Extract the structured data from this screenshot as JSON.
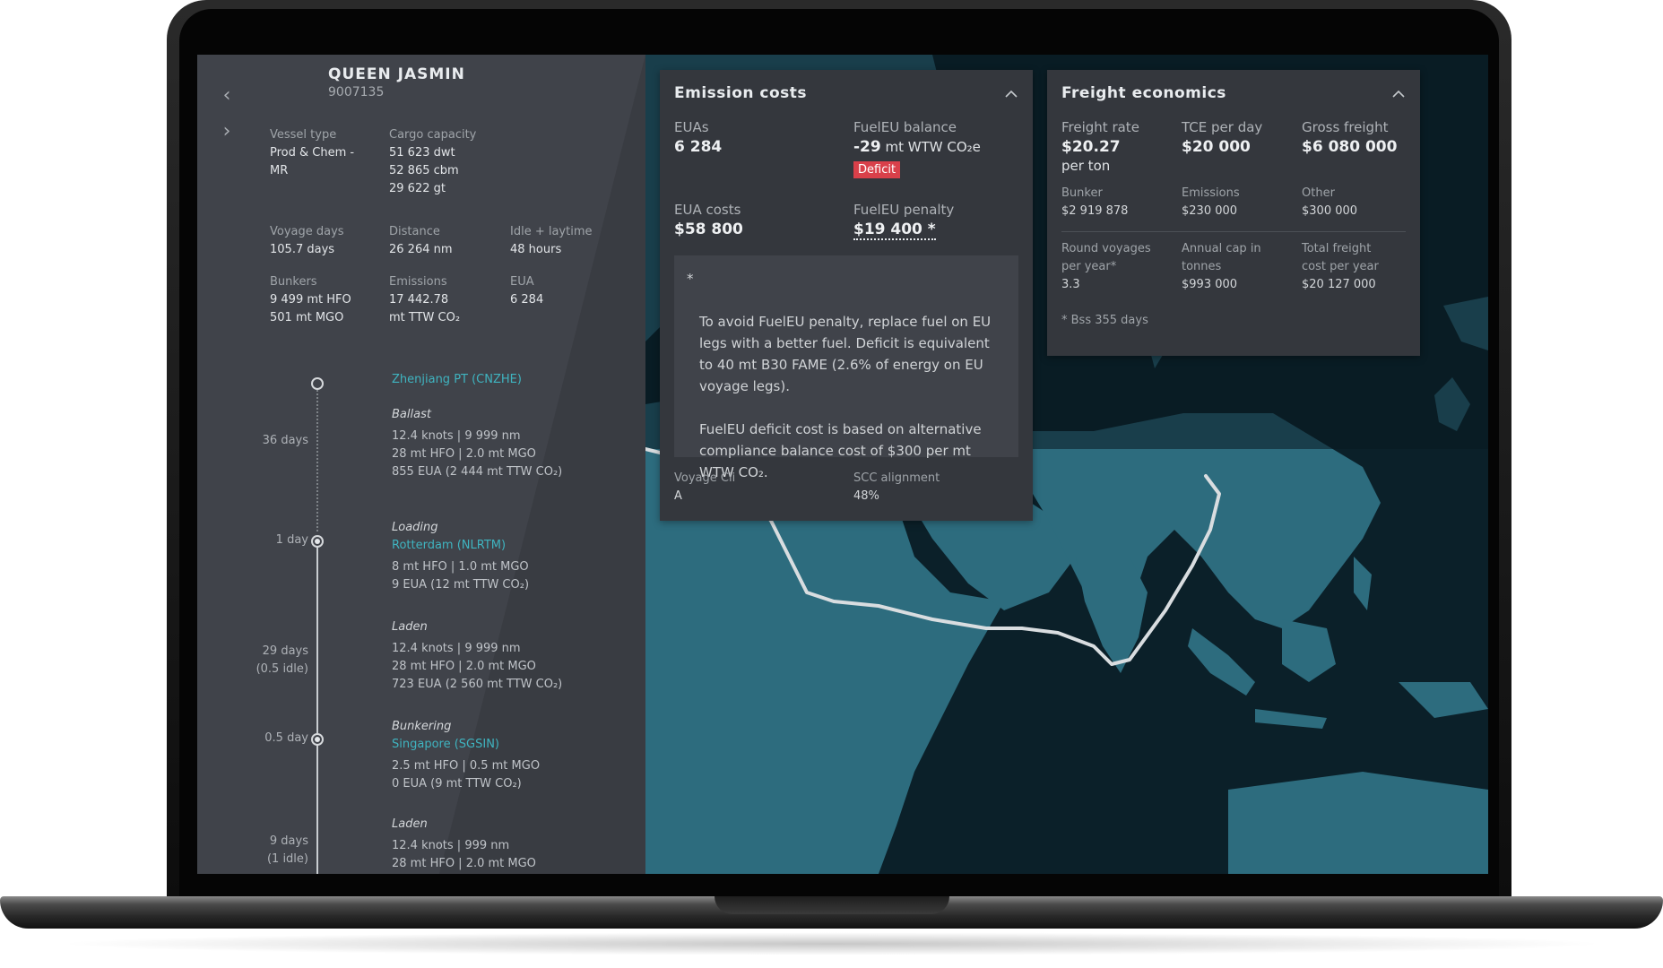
{
  "vessel": {
    "name": "QUEEN JASMIN",
    "imo": "9007135",
    "specs": {
      "vessel_type": {
        "label": "Vessel type",
        "value": "Prod & Chem -\nMR"
      },
      "cargo_capacity": {
        "label": "Cargo capacity",
        "value": "51 623 dwt\n52 865 cbm\n29 622 gt"
      },
      "voyage_days": {
        "label": "Voyage days",
        "value": "105.7 days"
      },
      "distance": {
        "label": "Distance",
        "value": "26 264 nm"
      },
      "idle_laytime": {
        "label": "Idle + laytime",
        "value": "48 hours"
      },
      "bunkers": {
        "label": "Bunkers",
        "value": "9 499 mt HFO\n501 mt MGO"
      },
      "emissions": {
        "label": "Emissions",
        "value": "17 442.78\nmt TTW CO₂"
      },
      "eua": {
        "label": "EUA",
        "value": "6 284"
      }
    }
  },
  "nav": {
    "prev": "‹",
    "next": "›"
  },
  "timeline": {
    "start_port": "Zhenjiang PT (CNZHE)",
    "legs": [
      {
        "days": "36 days",
        "type": "Ballast",
        "port": "",
        "detail": "12.4 knots | 9 999 nm\n28 mt HFO | 2.0 mt MGO\n855 EUA (2 444 mt TTW CO₂)"
      },
      {
        "days": "1 day",
        "type": "Loading",
        "port": "Rotterdam (NLRTM)",
        "detail": "8 mt HFO | 1.0 mt MGO\n9 EUA (12 mt TTW CO₂)"
      },
      {
        "days": "29 days\n(0.5 idle)",
        "type": "Laden",
        "port": "",
        "detail": "12.4 knots | 9 999 nm\n28 mt HFO | 2.0 mt MGO\n723 EUA (2 560 mt TTW CO₂)"
      },
      {
        "days": "0.5 day",
        "type": "Bunkering",
        "port": "Singapore (SGSIN)",
        "detail": "2.5 mt HFO | 0.5 mt MGO\n0 EUA (9 mt TTW CO₂)"
      },
      {
        "days": "9 days\n(1 idle)",
        "type": "Laden",
        "port": "",
        "detail": "12.4 knots | 999 nm\n28 mt HFO | 2.0 mt MGO"
      }
    ]
  },
  "emission_costs": {
    "title": "Emission costs",
    "euas": {
      "label": "EUAs",
      "value": "6 284"
    },
    "fueleu_balance": {
      "label": "FuelEU balance",
      "value": "-29",
      "unit": " mt WTW CO₂e",
      "badge": "Deficit"
    },
    "eua_costs": {
      "label": "EUA costs",
      "value": "$58 800"
    },
    "fueleu_penalty": {
      "label": "FuelEU penalty",
      "value": "$19 400 *"
    },
    "note_bullet": "*",
    "note": "To avoid FuelEU penalty, replace fuel on EU\nlegs with a better fuel. Deficit is equivalent\nto 40 mt B30 FAME (2.6% of energy on EU\nvoyage legs).\n\nFuelEU deficit cost is based on alternative\ncompliance balance cost of $300 per mt\nWTW CO₂.",
    "voyage_cii": {
      "label": "Voyage Cii",
      "value": "A"
    },
    "scc_alignment": {
      "label": "SCC alignment",
      "value": "48%"
    }
  },
  "freight_economics": {
    "title": "Freight economics",
    "freight_rate": {
      "label": "Freight rate",
      "value": "$20.27",
      "sub": "per ton"
    },
    "tce_per_day": {
      "label": "TCE per day",
      "value": "$20 000"
    },
    "gross_freight": {
      "label": "Gross freight",
      "value": "$6 080 000"
    },
    "bunker": {
      "label": "Bunker",
      "value": "$2 919 878"
    },
    "emissions": {
      "label": "Emissions",
      "value": "$230 000"
    },
    "other": {
      "label": "Other",
      "value": "$300 000"
    },
    "round_voyages": {
      "label": "Round voyages\nper year*",
      "value": "3.3"
    },
    "annual_cap": {
      "label": "Annual cap in\ntonnes",
      "value": "$993 000"
    },
    "total_freight_cost": {
      "label": "Total freight\ncost per year",
      "value": "$20 127 000"
    },
    "footnote": "* Bss 355 days"
  },
  "icons": {
    "collapse": "chevron-up-icon"
  },
  "colors": {
    "port_link": "#3fb4c0",
    "deficit_badge": "#d9404a",
    "ocean": "#0d2530",
    "land": "#2d6c7e",
    "route": "#d9dde0"
  }
}
